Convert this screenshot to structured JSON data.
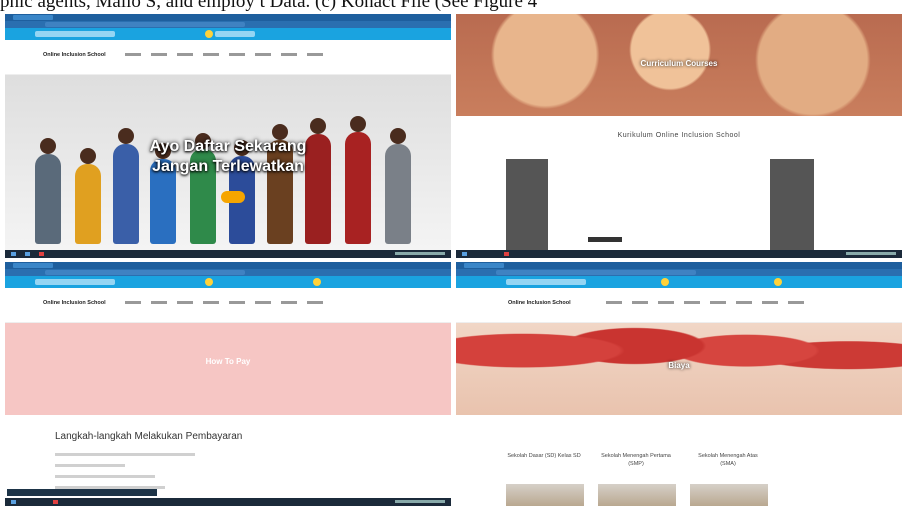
{
  "caption": "phic agents, Mailo S, and employ t Data. (c) Konact File (See Figure 4",
  "site": {
    "brand": "Online Inclusion School",
    "nav_items": [
      "HOME",
      "ABOUT",
      "REPORT",
      "CURRICULUM",
      "NEWS",
      "GALLERY",
      "SURVEY",
      "CONTACT",
      "LINK"
    ]
  },
  "quad1": {
    "hero_title": "Ayo Daftar Sekarang Jangan Terlewatkan"
  },
  "quad2": {
    "banner_title": "Curriculum Courses",
    "heading": "Kurikulum Online Inclusion School"
  },
  "quad3": {
    "banner_title": "How To Pay",
    "steps_title": "Langkah-langkah Melakukan Pembayaran"
  },
  "quad4": {
    "banner_title": "Biaya",
    "schools": [
      {
        "name": "Sekolah Dasar (SD) Kelas SD"
      },
      {
        "name": "Sekolah Menengah Pertama (SMP)"
      },
      {
        "name": "Sekolah Menengah Atas (SMA)"
      }
    ]
  },
  "colors": {
    "info_bar": "#1aa3e0",
    "pink": "#f6c6c4",
    "cta": "#f6a500"
  }
}
